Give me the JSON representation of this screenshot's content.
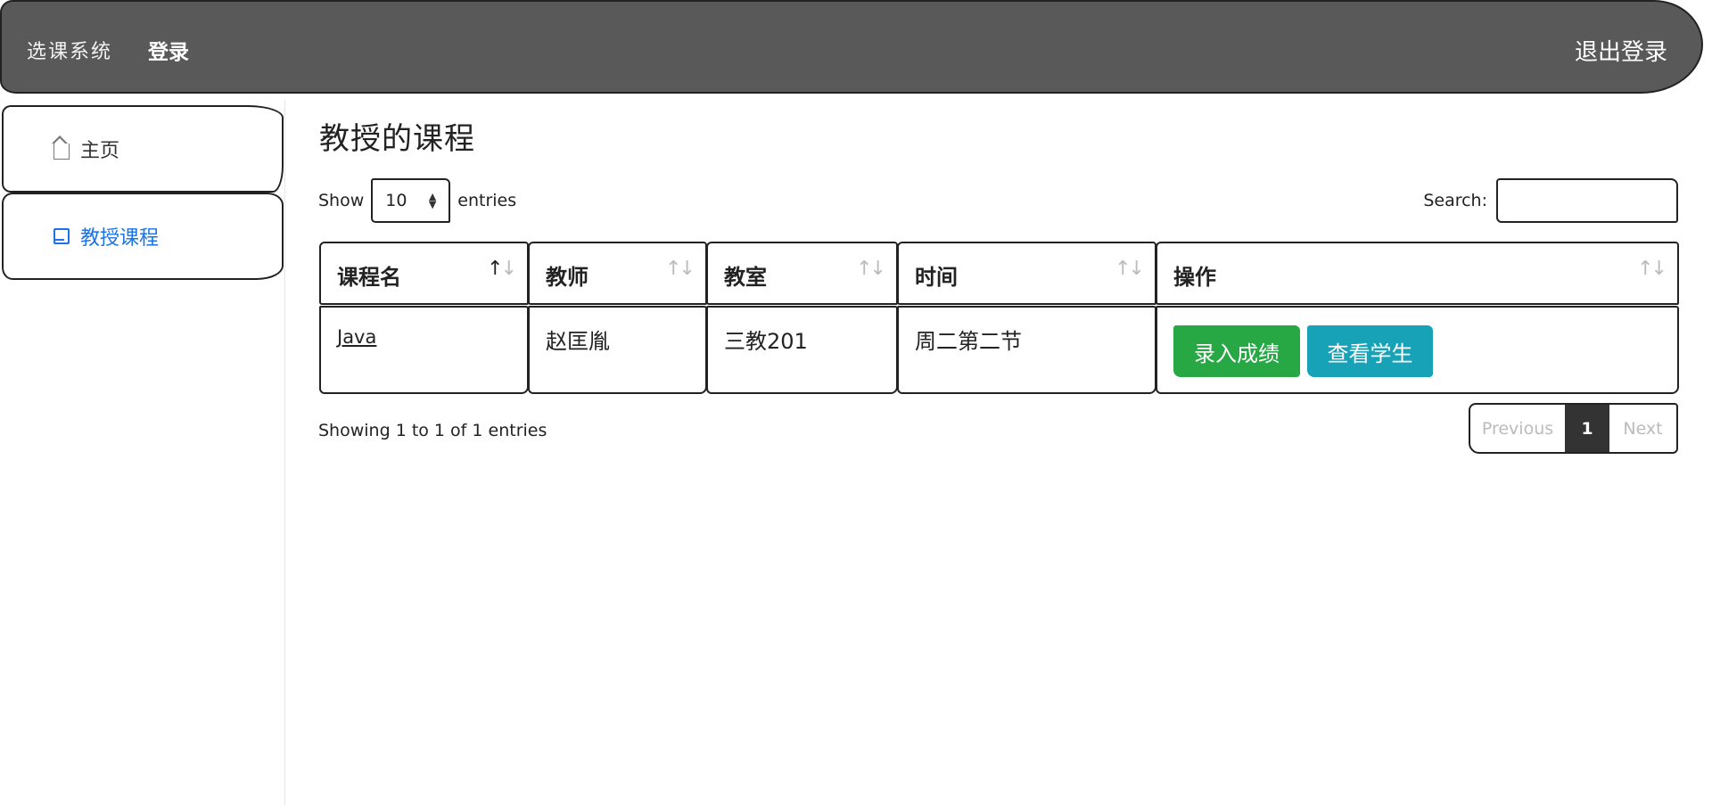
{
  "navbar": {
    "brand": "选课系统",
    "login": "登录",
    "logout": "退出登录"
  },
  "sidebar": {
    "items": [
      {
        "label": "主页",
        "icon": "home-icon"
      },
      {
        "label": "教授课程",
        "icon": "book-icon"
      }
    ]
  },
  "main": {
    "title": "教授的课程",
    "length": {
      "show_label": "Show",
      "value": "10",
      "entries_label": "entries"
    },
    "search": {
      "label": "Search:",
      "value": ""
    },
    "table": {
      "columns": [
        "课程名",
        "教师",
        "教室",
        "时间",
        "操作"
      ],
      "rows": [
        {
          "course": "Java",
          "teacher": "赵匡胤",
          "room": "三教201",
          "time": "周二第二节",
          "actions": [
            "录入成绩",
            "查看学生"
          ]
        }
      ]
    },
    "info": "Showing 1 to 1 of 1 entries",
    "pagination": {
      "previous": "Previous",
      "current": "1",
      "next": "Next"
    }
  },
  "colors": {
    "navbar": "#595959",
    "active_link": "#1a73e8",
    "button_green": "#28a745",
    "button_teal": "#17a2b8",
    "page_active": "#333333"
  }
}
